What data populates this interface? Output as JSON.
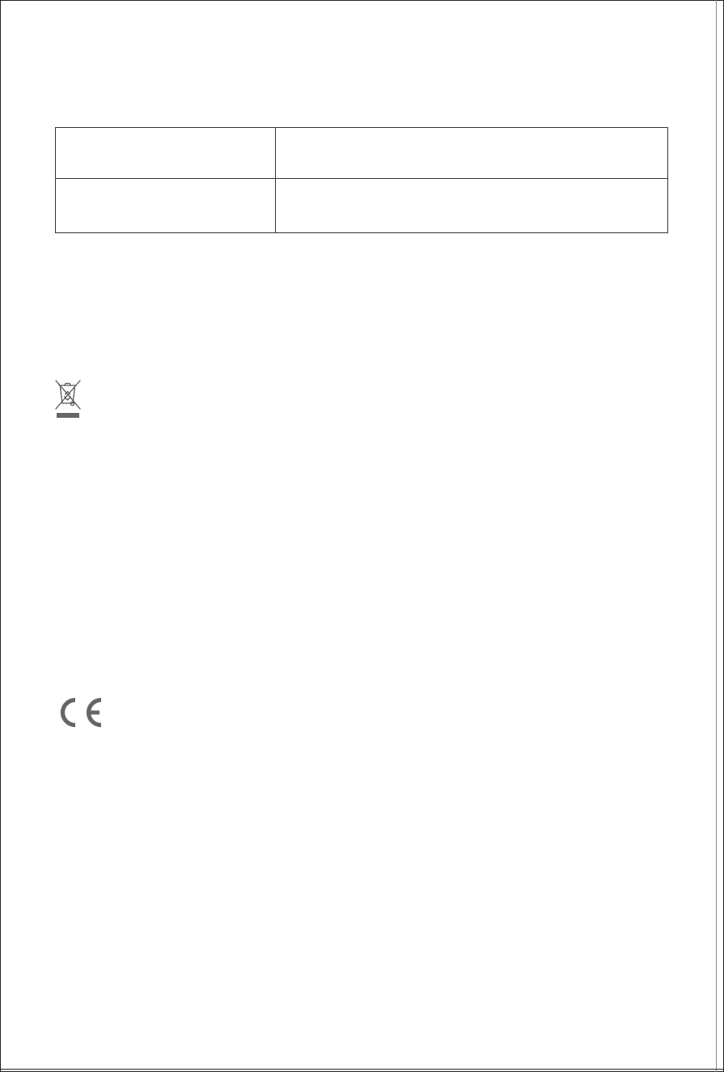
{
  "spec_table": {
    "rows": [
      {
        "label": "",
        "value": ""
      },
      {
        "label": "",
        "value": ""
      }
    ]
  },
  "icons": {
    "weee": "crossed-out-wheelie-bin-icon",
    "ce": "ce-mark-icon"
  },
  "colors": {
    "page_background": "#ffffff",
    "border": "#333333",
    "icon_gray": "#666666"
  }
}
